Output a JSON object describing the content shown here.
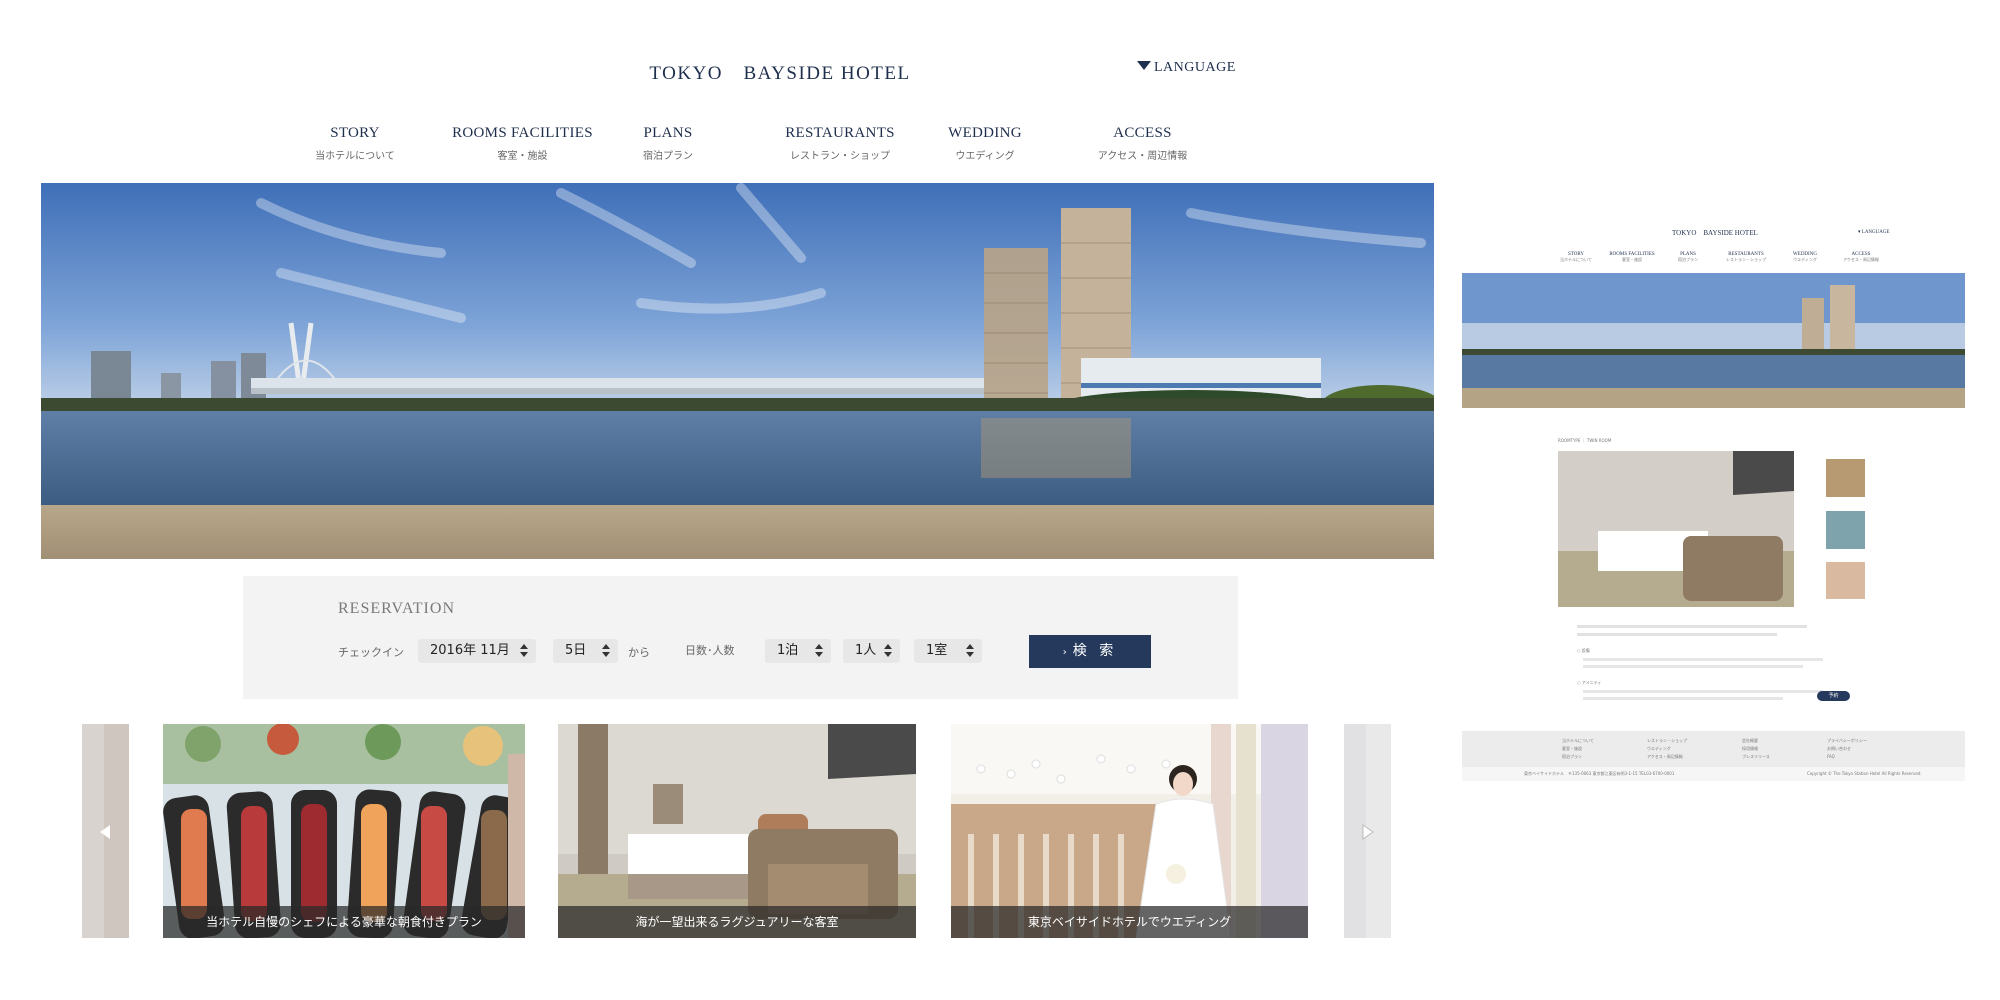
{
  "header": {
    "logo": "TOKYO　BAYSIDE HOTEL",
    "language": "LANGUAGE"
  },
  "nav": [
    {
      "en": "STORY",
      "ja": "当ホテルについて"
    },
    {
      "en": "ROOMS FACILITIES",
      "ja": "客室・施設"
    },
    {
      "en": "PLANS",
      "ja": "宿泊プラン"
    },
    {
      "en": "RESTAURANTS",
      "ja": "レストラン・ショップ"
    },
    {
      "en": "WEDDING",
      "ja": "ウエディング"
    },
    {
      "en": "ACCESS",
      "ja": "アクセス・周辺情報"
    }
  ],
  "reservation": {
    "title": "RESERVATION",
    "checkin_label": "チェックイン",
    "month": "2016年 11月",
    "day": "5日",
    "from": "から",
    "nights_label": "日数･人数",
    "nights": "1泊",
    "people": "1人",
    "rooms": "1室",
    "search": "検 索"
  },
  "carousel": {
    "cards": [
      {
        "caption": "当ホテル自慢のシェフによる豪華な朝食付きプラン"
      },
      {
        "caption": "海が一望出来るラグジュアリーな客室"
      },
      {
        "caption": "東京ベイサイドホテルでウエディング"
      }
    ]
  },
  "mini": {
    "logo": "TOKYO　BAYSIDE HOTEL",
    "language": "LANGUAGE",
    "nav": [
      {
        "en": "STORY",
        "ja": "当ホテルについて"
      },
      {
        "en": "ROOMS FACILITIES",
        "ja": "客室・施設"
      },
      {
        "en": "PLANS",
        "ja": "宿泊プラン"
      },
      {
        "en": "RESTAURANTS",
        "ja": "レストラン・ショップ"
      },
      {
        "en": "WEDDING",
        "ja": "ウエディング"
      },
      {
        "en": "ACCESS",
        "ja": "アクセス・周辺情報"
      }
    ],
    "breadcrumb": "ROOMTYPE ｜ TWIN ROOM",
    "amenity1": "設備",
    "amenity2": "アメニティ",
    "reserve": "予約",
    "footer_links": [
      "当ホテルについて",
      "レストラン・ショップ",
      "会社概要",
      "プライバシーポリシー",
      "客室・施設",
      "ウエディング",
      "採用情報",
      "お問い合わせ",
      "宿泊プラン",
      "アクセス・周辺情報",
      "プレスリリース",
      "FAQ"
    ],
    "footer_address": "東京ベイサイドホテル　〒135-0063 東京都江東区有明3-1-15 TEL03-6700-0001",
    "copyright": "Copyright © The Tokyo Station Hotel All Rights Reserved."
  },
  "colors": {
    "navy": "#1e2f4d",
    "button": "#24395c",
    "panel": "#f3f3f3"
  }
}
